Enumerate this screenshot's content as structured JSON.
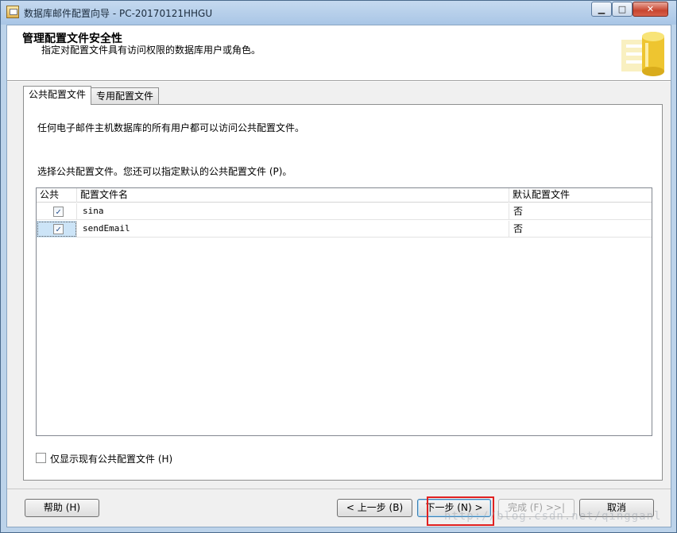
{
  "window": {
    "title": "数据库邮件配置向导 - PC-20170121HHGU",
    "minimize_glyph": "▁",
    "maximize_glyph": "□",
    "close_glyph": "✕"
  },
  "header": {
    "title": "管理配置文件安全性",
    "subtitle": "指定对配置文件具有访问权限的数据库用户或角色。",
    "icon": "database-icon"
  },
  "tabs": [
    {
      "label": "公共配置文件",
      "active": true
    },
    {
      "label": "专用配置文件",
      "active": false
    }
  ],
  "panel": {
    "description": "任何电子邮件主机数据库的所有用户都可以访问公共配置文件。",
    "instruction": "选择公共配置文件。您还可以指定默认的公共配置文件 (P)。"
  },
  "grid": {
    "columns": [
      "公共",
      "配置文件名",
      "默认配置文件"
    ],
    "rows": [
      {
        "public": true,
        "name": "sina",
        "default": "否",
        "selected": false
      },
      {
        "public": true,
        "name": "sendEmail",
        "default": "否",
        "selected": true
      }
    ]
  },
  "filter": {
    "label": "仅显示现有公共配置文件 (H)",
    "checked": false
  },
  "buttons": {
    "help": "帮助 (H)",
    "back": "< 上一步 (B)",
    "next": "下一步 (N) >",
    "finish": "完成 (F) >>|",
    "cancel": "取消"
  },
  "watermark": "http://blog.csdn.net/qingganl",
  "colors": {
    "highlight": "#e02020",
    "selection": "#cce4f7"
  }
}
